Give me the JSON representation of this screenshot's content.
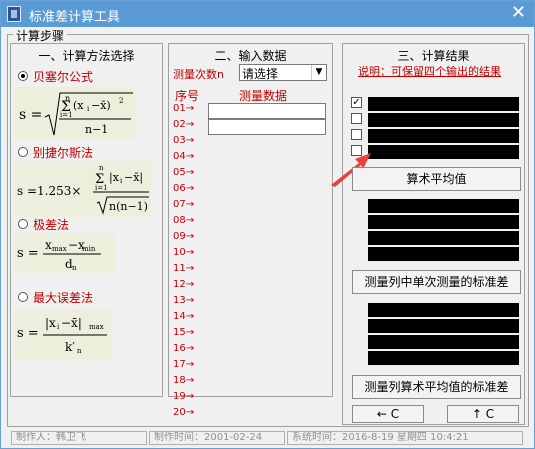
{
  "window": {
    "title": "标准差计算工具"
  },
  "frame_label": "计算步骤",
  "left_panel": {
    "title": "一、计算方法选择",
    "methods": [
      {
        "label": "贝塞尔公式",
        "selected": true,
        "formula": "s = √( Σ(xᵢ − x̄)² / (n−1) )"
      },
      {
        "label": "别捷尔斯法",
        "selected": false,
        "formula": "s = 1.253 × Σ|xᵢ − x̄| / √(n(n−1))"
      },
      {
        "label": "极差法",
        "selected": false,
        "formula": "s = (xmax − xmin) / dn"
      },
      {
        "label": "最大误差法",
        "selected": false,
        "formula": "s = |xᵢ − x̄|max / k′n"
      }
    ]
  },
  "middle_panel": {
    "title": "二、输入数据",
    "count_label": "测量次数n",
    "select_value": "请选择",
    "seq_header": "序号",
    "data_header": "测量数据",
    "rows": [
      "01→",
      "02→",
      "03→",
      "04→",
      "05→",
      "06→",
      "07→",
      "08→",
      "09→",
      "10→",
      "11→",
      "12→",
      "13→",
      "14→",
      "15→",
      "16→",
      "17→",
      "18→",
      "19→",
      "20→"
    ]
  },
  "right_panel": {
    "title": "三、计算结果",
    "note": "说明：可保留四个输出的结果",
    "btn_mean": "算术平均值",
    "btn_std_single": "测量列中单次测量的标准差",
    "btn_std_mean": "测量列算术平均值的标准差",
    "btn_back": "← C",
    "btn_up": "↑ C"
  },
  "status": {
    "author": "制作人：韩卫飞",
    "made_time": "制作时间：2001-02-24",
    "sys_time": "系统时间：2016-8-19  星期四  10:4:21"
  },
  "colors": {
    "title_bg": "#5b9bd5",
    "accent_red": "#c00000"
  }
}
